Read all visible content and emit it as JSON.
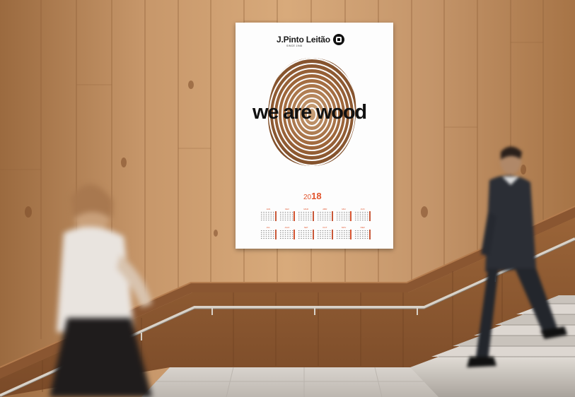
{
  "poster": {
    "brand": "J.Pinto Leitão",
    "since": "SINCE 1946",
    "headline": "we are wood",
    "year_prefix": "20",
    "year_suffix": "18"
  },
  "calendar": {
    "months": [
      "JAN",
      "FEV",
      "MAR",
      "ABR",
      "MAI",
      "JUN",
      "JUL",
      "AGO",
      "SET",
      "OUT",
      "NOV",
      "DEZ"
    ]
  },
  "colors": {
    "wood_light": "#c89a6a",
    "wood_dark": "#8a5a33",
    "accent": "#e2532b",
    "floor": "#cbc6c0"
  }
}
